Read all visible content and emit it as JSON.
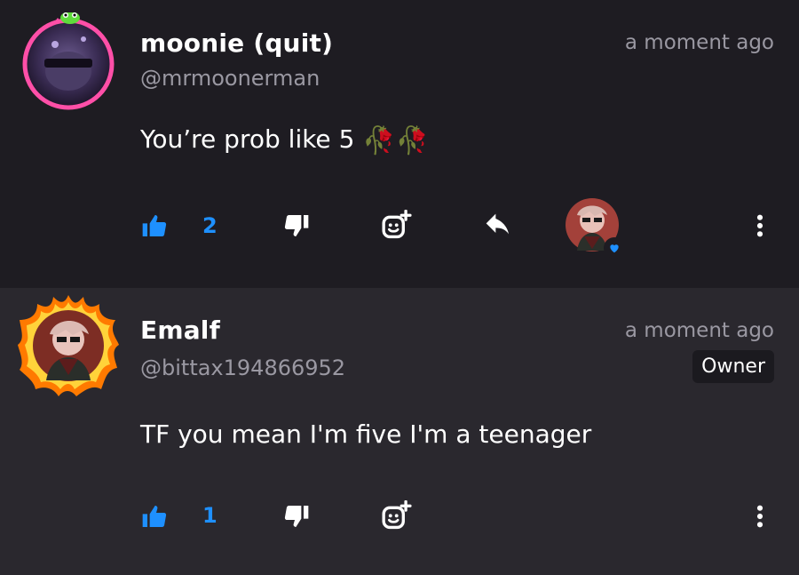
{
  "comments": [
    {
      "display_name": "moonie (quit)",
      "handle": "@mrmoonerman",
      "time": "a moment ago",
      "text": "You’re prob like 5",
      "emoji": "🥀🥀",
      "likes": "2",
      "has_reply_button": true,
      "has_reactor_avatar": true
    },
    {
      "display_name": "Emalf",
      "handle": "@bittax194866952",
      "time": "a moment ago",
      "badge": "Owner",
      "text": "TF you mean I'm five I'm a teenager",
      "likes": "1"
    }
  ],
  "colors": {
    "like_blue": "#1e90ff",
    "muted_text": "#9a98a2",
    "bg_dark": "#1e1c22",
    "bg_light": "#2a282e",
    "avatar_ring_pink": "#ff4fa8"
  },
  "icons": {
    "like": "thumbs-up-icon",
    "dislike": "thumbs-down-icon",
    "react": "add-reaction-icon",
    "reply": "reply-arrow-icon",
    "more": "more-vertical-icon",
    "heart": "heart-icon"
  }
}
